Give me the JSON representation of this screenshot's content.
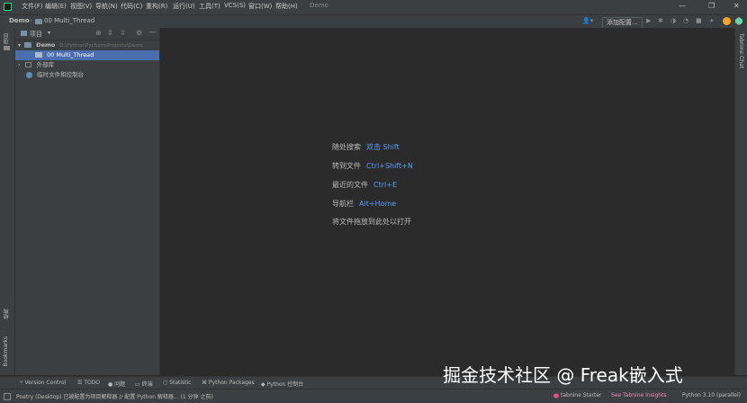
{
  "menubar": {
    "items": [
      "文件(F)",
      "编辑(E)",
      "视图(V)",
      "导航(N)",
      "代码(C)",
      "重构(R)",
      "运行(U)",
      "工具(T)",
      "VCS(S)",
      "窗口(W)",
      "帮助(H)"
    ],
    "title": "Demo",
    "min": "—",
    "restore": "❐",
    "close": "✕"
  },
  "navbar": {
    "project": "Demo",
    "folder": "00 Multi_Thread",
    "add_config": "添加配置..."
  },
  "leftstrip": {
    "project_label": "项目",
    "structure_label": "结构",
    "bookmarks_label": "Bookmarks"
  },
  "project_panel": {
    "title": "项目",
    "root_name": "Demo",
    "root_path": "D:\\Python\\PycharmProjects\\Demo",
    "selected": "00 Multi_Thread",
    "external_libs": "外部库",
    "scratches": "临时文件和控制台"
  },
  "editor": {
    "hints": [
      {
        "label": "随处搜索",
        "key": "双击 Shift"
      },
      {
        "label": "转到文件",
        "key": "Ctrl+Shift+N"
      },
      {
        "label": "最近的文件",
        "key": "Ctrl+E"
      },
      {
        "label": "导航栏",
        "key": "Alt+Home"
      },
      {
        "label": "将文件拖放到此处以打开",
        "key": ""
      }
    ]
  },
  "rightstrip": {
    "tabnine": "Tabnine Chat"
  },
  "bottom_tools": [
    "Version Control",
    "TODO",
    "问题",
    "终端",
    "Statistic",
    "Python Packages",
    "Python 控制台"
  ],
  "status": {
    "message": "Poetry (Desktop) 已被配置为项目解释器 // 配置 Python 解释器... (1 分钟 之前)",
    "tabnine": "tabnine Starter",
    "insights": "See Tabnine Insights",
    "interpreter": "Python 3.10 (parallel)"
  },
  "watermark": "掘金技术社区 @ Freak嵌入式",
  "colors": {
    "accent": "#589df6",
    "selection": "#4b6eaf"
  }
}
